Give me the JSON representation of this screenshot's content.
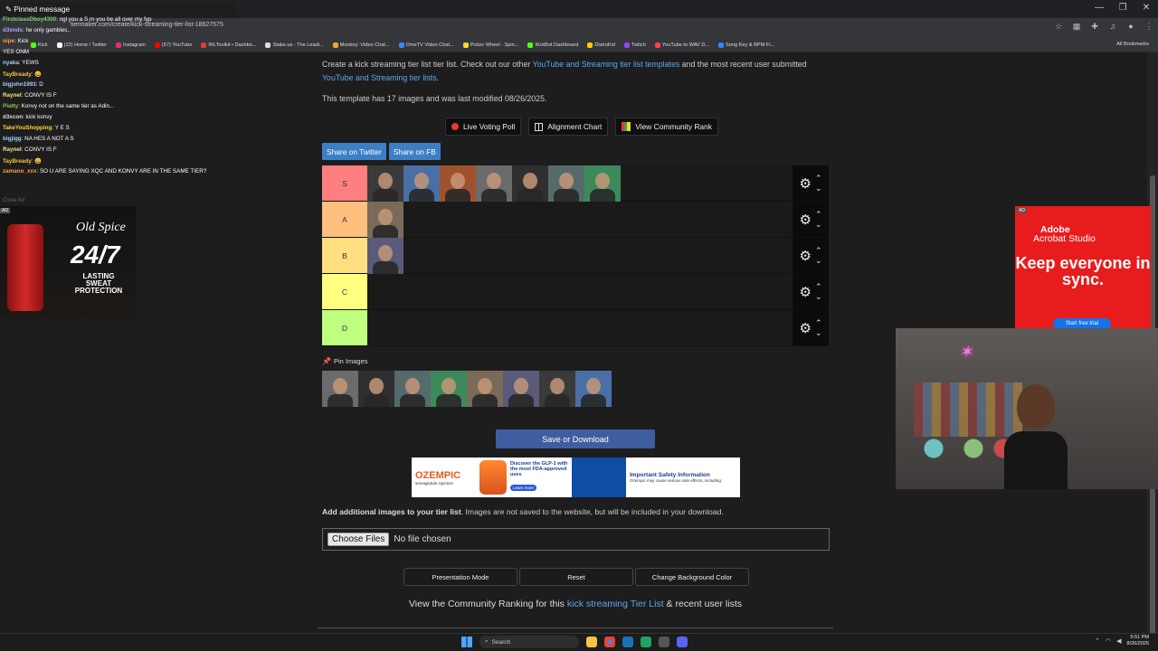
{
  "browser": {
    "url": "tiermaker.com/create/kick-streaming-tier-list-18627575",
    "window_controls": [
      "—",
      "❐",
      "✕"
    ],
    "bookmarks": [
      {
        "label": "Kick",
        "color": "#53fc18"
      },
      {
        "label": "(12) Home / Twitter",
        "color": "#ffffff"
      },
      {
        "label": "Instagram",
        "color": "#e1306c"
      },
      {
        "label": "(57) YouTube",
        "color": "#ff0000"
      },
      {
        "label": "IRLToolkit • Dashbo...",
        "color": "#e53935"
      },
      {
        "label": "Stake.us - The Leadi...",
        "color": "#dddddd"
      },
      {
        "label": "Monkey: Video Chat...",
        "color": "#f5a623"
      },
      {
        "label": "OmeTV Video Chat...",
        "color": "#2a8cff"
      },
      {
        "label": "Picker Wheel - Spin...",
        "color": "#fdd835"
      },
      {
        "label": "KickBot Dashboard",
        "color": "#53fc18"
      },
      {
        "label": "DistroKid",
        "color": "#ffcc00"
      },
      {
        "label": "Twitch",
        "color": "#9146ff"
      },
      {
        "label": "YouTube to WAV D...",
        "color": "#ff4444"
      },
      {
        "label": "Song Key & BPM Fi...",
        "color": "#2a8cff"
      }
    ],
    "all_bookmarks": "All Bookmarks"
  },
  "page": {
    "intro_prefix": "Create a kick streaming tier list tier list. Check out our other ",
    "intro_link1": "YouTube and Streaming tier list templates",
    "intro_mid": " and the most recent user submitted ",
    "intro_link2": "YouTube and Streaming tier lists",
    "intro_end": ".",
    "meta": "This template has 17 images and was last modified 08/26/2025.",
    "buttons": {
      "live_voting": "Live Voting Poll",
      "alignment": "Alignment Chart",
      "community_rank": "View Community Rank"
    },
    "share": {
      "twitter": "Share on Twitter",
      "fb": "Share on FB"
    },
    "tiers": [
      {
        "label": "S",
        "color": "#ff7f7f",
        "count": 7
      },
      {
        "label": "A",
        "color": "#ffbf7f",
        "count": 1
      },
      {
        "label": "B",
        "color": "#ffdf7f",
        "count": 1
      },
      {
        "label": "C",
        "color": "#ffff7f",
        "count": 0
      },
      {
        "label": "D",
        "color": "#bfff7f",
        "count": 0
      }
    ],
    "pin_title": "Pin Images",
    "pin_count": 8,
    "save": "Save or Download",
    "add_bold": "Add additional images to your tier list",
    "add_rest": ". Images are not saved to the website, but will be included in your download.",
    "file_button": "Choose Files",
    "file_status": "No file chosen",
    "options": [
      "Presentation Mode",
      "Reset",
      "Change Background Color"
    ],
    "community_prefix": "View the Community Ranking for this ",
    "community_link": "kick streaming Tier List",
    "community_suffix": " & recent user lists"
  },
  "ads": {
    "mid": {
      "brand": "OZEMPIC",
      "brand_sub": "semaglutide injection",
      "headline": "Discover the GLP-1 with the most FDA-approved uses",
      "cta": "Learn more",
      "isi_title": "Important Safety Information",
      "isi_text": "Ozempic may cause serious side effects, including:"
    },
    "left": {
      "tag": "AD",
      "brand": "Old Spice",
      "big": "24/7",
      "line": "LASTING SWEAT PROTECTION"
    },
    "right": {
      "tag": "AD",
      "l1": "Adobe",
      "l2": "Acrobat Studio",
      "headline": "Keep everyone in sync.",
      "cta": "Start free trial"
    },
    "close_ad": "Close Ad"
  },
  "chat": {
    "pinned": "Pinned message",
    "lines": [
      {
        "user": "FirstclassDboy4300",
        "color": "#7fd17f",
        "text": "ngl you a S rn you be all over my fyp"
      },
      {
        "user": "d3xnds",
        "color": "#aaaaff",
        "text": "he only gambles.."
      },
      {
        "user": "oipe",
        "color": "#ff9f40",
        "text": "Kick"
      },
      {
        "user": "",
        "color": "#ff6b6b",
        "text": "YES ONM"
      },
      {
        "user": "nyaka",
        "color": "#9fd0ff",
        "text": "YEWS"
      },
      {
        "user": "TayBready",
        "color": "#f5c542",
        "text": "😀"
      },
      {
        "user": "bigjohn1993",
        "color": "#9fd0ff",
        "text": "D"
      },
      {
        "user": "Raynel",
        "color": "#f0e68c",
        "text": "CONVY IS F"
      },
      {
        "user": "Piatty",
        "color": "#8bc34a",
        "text": "Konvy not on the same tier as Adin..."
      },
      {
        "user": "d3xcon",
        "color": "#dddddd",
        "text": "kick konvy"
      },
      {
        "user": "TakeYouShopping",
        "color": "#fdd835",
        "text": "Y E S"
      },
      {
        "user": "bigjigg",
        "color": "#9fd0ff",
        "text": "NA HES A NOT A S"
      },
      {
        "user": "Raynel",
        "color": "#f0e68c",
        "text": "CONVY IS F"
      },
      {
        "user": "TayBready",
        "color": "#f5c542",
        "text": "😀"
      },
      {
        "user": "zamano_xxx",
        "color": "#ff9f40",
        "text": "SO U ARE SAYING XQC AND KONVY ARE IN THE SAME TIER?"
      }
    ]
  },
  "taskbar": {
    "search": "Search",
    "time": "5:51 PM",
    "date": "8/26/2025"
  }
}
